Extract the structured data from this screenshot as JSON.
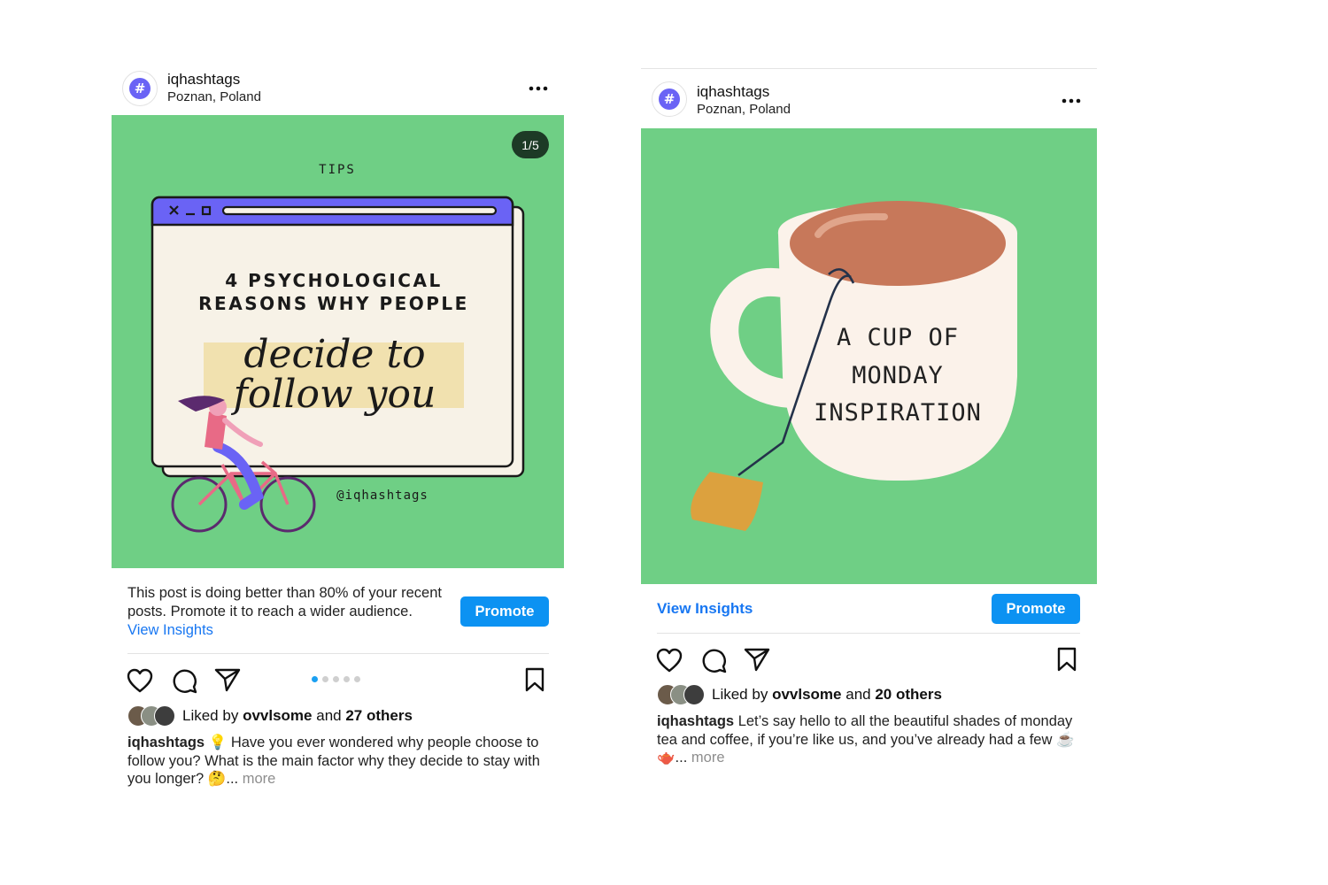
{
  "post1": {
    "username": "iqhashtags",
    "location": "Poznan, Poland",
    "avatar_symbol": "#",
    "slide_counter": "1/5",
    "image": {
      "tag": "TIPS",
      "headline_line1": "4 PSYCHOLOGICAL",
      "headline_line2": "REASONS WHY PEOPLE",
      "script_line1": "decide to",
      "script_line2": "follow you",
      "handle": "@iqhashtags"
    },
    "promo": {
      "text": "This post is doing better than 80% of your recent posts. Promote it to reach a wider audience.",
      "link": "View Insights",
      "button": "Promote"
    },
    "carousel": {
      "count": 5,
      "active": 0
    },
    "likes": {
      "prefix": "Liked by",
      "user": "ovvlsome",
      "middle": "and",
      "others": "27 others"
    },
    "caption": {
      "user": "iqhashtags",
      "text": "💡 Have you ever wondered why people choose to follow you? What is the main factor why they decide to stay with you longer? 🤔...",
      "more": "more"
    }
  },
  "post2": {
    "username": "iqhashtags",
    "location": "Poznan, Poland",
    "avatar_symbol": "#",
    "image": {
      "line1": "A CUP OF",
      "line2": "MONDAY",
      "line3": "INSPIRATION"
    },
    "promo": {
      "link": "View Insights",
      "button": "Promote"
    },
    "likes": {
      "prefix": "Liked by",
      "user": "ovvlsome",
      "middle": "and",
      "others": "20 others"
    },
    "caption": {
      "user": "iqhashtags",
      "text": "Let’s say hello to all the beautiful shades of monday tea and coffee, if you’re like us, and you’ve already had a few ☕ 🫖...",
      "more": "more"
    }
  },
  "colors": {
    "media_green": "#6fcf85",
    "promote_blue": "#0c92f2",
    "link_blue": "#1877f2",
    "active_dot": "#1ba0f2",
    "avatar_purple": "#6a63f5"
  }
}
